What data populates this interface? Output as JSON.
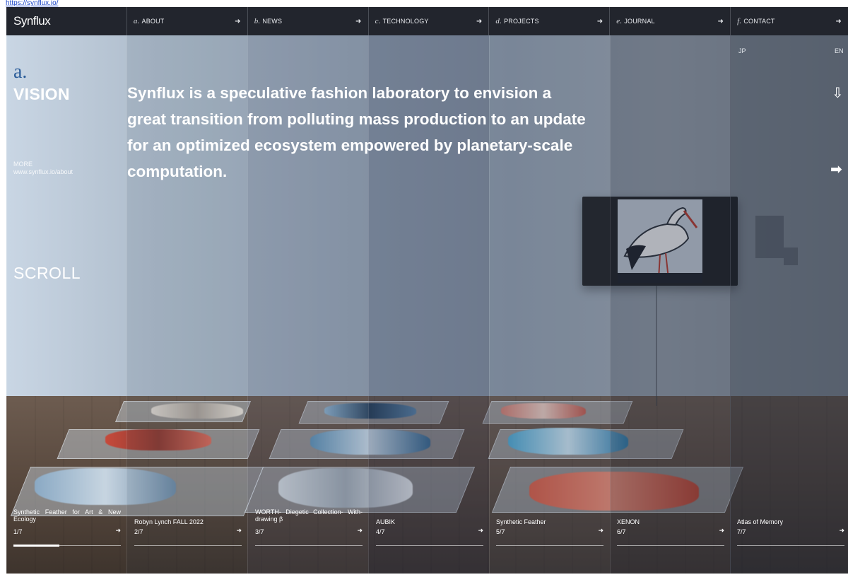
{
  "url": "https://synflux.io/",
  "brand": {
    "logo_text": "Synflux"
  },
  "nav": [
    {
      "mark": "a.",
      "label": "ABOUT"
    },
    {
      "mark": "b.",
      "label": "NEWS"
    },
    {
      "mark": "c.",
      "label": "TECHNOLOGY"
    },
    {
      "mark": "d.",
      "label": "PROJECTS"
    },
    {
      "mark": "e.",
      "label": "JOURNAL"
    },
    {
      "mark": "f.",
      "label": "CONTACT"
    }
  ],
  "nav_arrow": "➜",
  "section": {
    "letter": "a.",
    "title": "VISION",
    "more_label": "MORE",
    "more_url": "www.synflux.io/about",
    "scroll_label": "SCROLL"
  },
  "headline": "Synflux is a speculative fashion laboratory to envision a great transition from polluting mass production to an update for an optimized ecosystem empowered by planetary-scale computation.",
  "languages": {
    "jp": "JP",
    "en": "EN"
  },
  "controls": {
    "down_arrow": "⇩",
    "right_arrow": "➡"
  },
  "projects": [
    {
      "title": "Synthetic Feather for Art & New Ecology",
      "index": "1/7",
      "progress": 0.43
    },
    {
      "title": "Robyn Lynch FALL 2022",
      "index": "2/7"
    },
    {
      "title": "WORTH- Diegetic Collection- With-drawing β",
      "index": "3/7"
    },
    {
      "title": "AUBIK",
      "index": "4/7"
    },
    {
      "title": "Synthetic Feather",
      "index": "5/7"
    },
    {
      "title": "XENON",
      "index": "6/7"
    },
    {
      "title": "Atlas of Memory",
      "index": "7/7"
    }
  ],
  "card_arrow": "➜",
  "colors": {
    "topbar": "#22252d",
    "accent_letter": "#2c5d9a",
    "column_tints": [
      "rgba(255,255,255,0.0)",
      "rgba(40,55,80,0.10)",
      "rgba(60,70,95,0.22)",
      "rgba(30,40,70,0.30)",
      "rgba(55,65,90,0.24)",
      "rgba(35,45,65,0.36)",
      "rgba(30,38,55,0.48)"
    ]
  }
}
